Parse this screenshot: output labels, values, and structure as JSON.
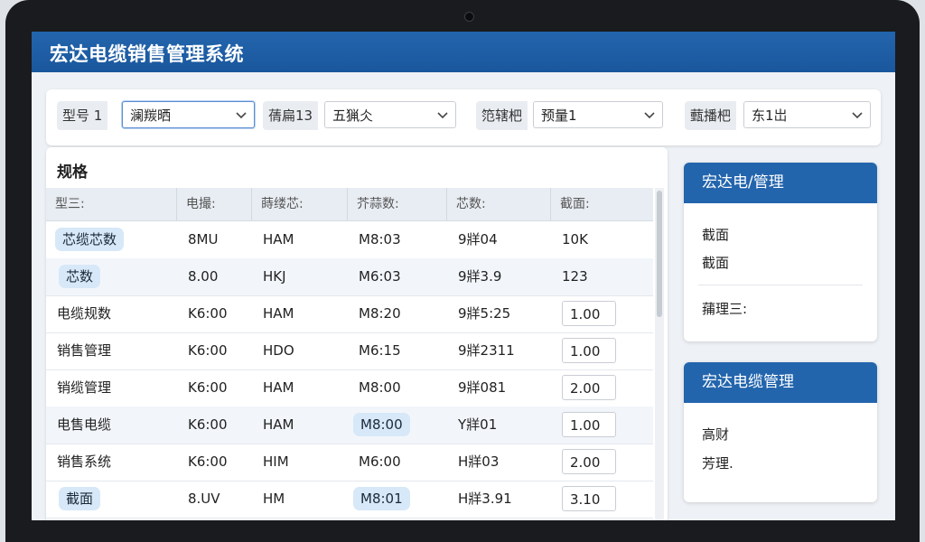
{
  "app": {
    "title": "宏达电缆销售管理系统"
  },
  "filters": [
    {
      "label": "型号 1",
      "value": "澜羰晒"
    },
    {
      "label": "蒨扁13",
      "value": "五猟仌"
    },
    {
      "label": "笵辖杷",
      "value": "预量1"
    },
    {
      "label": "薽播杷",
      "value": "东1岀"
    }
  ],
  "table": {
    "title": "规格",
    "headers": [
      "型三:",
      "电撮:",
      "蒔缕芯:",
      "芥蒜数:",
      "芯数:",
      "截面:"
    ],
    "rows": [
      {
        "c1": "芯缆芯数",
        "c2": "8MU",
        "c3": "HAM",
        "c4": "M8:03",
        "c5": "9牂04",
        "c6": "10K"
      },
      {
        "c1": "芯数",
        "c2": "8.00",
        "c3": "HKJ",
        "c4": "M6:03",
        "c5": "9牂3.9",
        "c6": "123"
      },
      {
        "c1": "电缆规数",
        "c2": "K6:00",
        "c3": "HAM",
        "c4": "M8:20",
        "c5": "9牂5:25",
        "c6": "1.00"
      },
      {
        "c1": "销售管理",
        "c2": "K6:00",
        "c3": "HDO",
        "c4": "M6:15",
        "c5": "9牂2311",
        "c6": "1.00"
      },
      {
        "c1": "销缆管理",
        "c2": "K6:00",
        "c3": "HAM",
        "c4": "M8:00",
        "c5": "9牂081",
        "c6": "2.00"
      },
      {
        "c1": "电售电缆",
        "c2": "K6:00",
        "c3": "HAM",
        "c4": "M8:00",
        "c5": "Y牂01",
        "c6": "1.00"
      },
      {
        "c1": "销售系统",
        "c2": "K6:00",
        "c3": "HIM",
        "c4": "M6:00",
        "c5": "H牂03",
        "c6": "2.00"
      },
      {
        "c1": "截面",
        "c2": "8.UV",
        "c3": "HM",
        "c4": "M8:01",
        "c5": "H牂3.91",
        "c6": "3.10"
      }
    ]
  },
  "side_panels": [
    {
      "title": "宏达电/管理",
      "items": [
        "截面",
        "截面",
        "蒱理三:"
      ]
    },
    {
      "title": "宏达电缆管理",
      "items": [
        "高财",
        "芳理."
      ]
    }
  ]
}
